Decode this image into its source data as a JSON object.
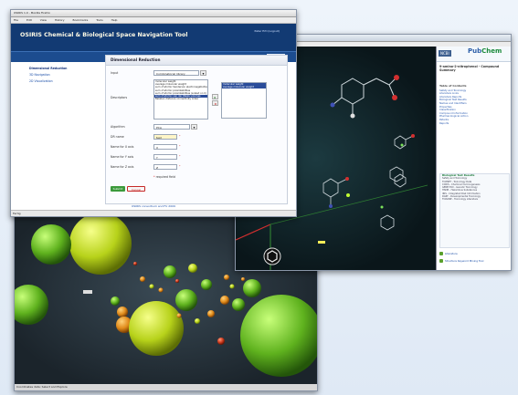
{
  "osiris": {
    "window_title": "OSIRIS 1.0 - Mozilla Firefox",
    "menu": [
      "File",
      "Edit",
      "View",
      "History",
      "Bookmarks",
      "Tools",
      "Help"
    ],
    "app_title": "OSIRIS Chemical & Biological Space Navigation Tool",
    "user_link": "Peter Ertl (Logout)",
    "help_label": "Help",
    "sidebar": [
      "Dimensional Reduction",
      "3D Navigation",
      "2D Visualization"
    ],
    "panel_title": "Dimensional Reduction",
    "fields": {
      "input_label": "Input",
      "input_value": "Combinatorial library",
      "descriptors_label": "Descriptors",
      "descriptors_available": [
        "molecular weight",
        "average molecular weight",
        "",
        "sum of atomic Sanderson electronegativities",
        "sum of atomic polarizabilities",
        "sum of atomic polarizabilities (scaled on C)",
        "sum of atomic van der Waals volumes",
        "Balaban distance connectivity index"
      ],
      "descriptors_selected": [
        "molecular weight",
        "average molecular weight"
      ],
      "algorithm_label": "Algorithm",
      "algorithm_value": "PCA",
      "dr_name_label": "DR name",
      "dr_name_value": "test",
      "x_axis_label": "Name for X axis",
      "x_axis_value": "X",
      "y_axis_label": "Name for Y axis",
      "y_axis_value": "Y",
      "z_axis_label": "Name for Z axis",
      "z_axis_value": "Z",
      "required_note": "required field",
      "submit_label": "Submit",
      "cancel_label": "Cancel"
    },
    "footer": "OSIRIS consortium and FU 2009",
    "status": "Fertig"
  },
  "pubchem": {
    "ncbi_label": "NCBI",
    "logo_main": "Pub",
    "logo_chem": "Chem",
    "compound_title": "9-amino-2-nitrophenol - Compound Summary",
    "toc_heading": "Table of Contents",
    "toc_items": [
      "Safety and Toxicology",
      "Literature Links",
      "Literature Reports",
      "Biological Test Results",
      "Names and Identifiers",
      "Properties",
      "Classification",
      "Compound Information",
      "Pharmacological Action",
      "Patents",
      "Reports"
    ],
    "bio_heading": "Biological Test Results",
    "bio_lines": [
      "Safety and Toxicology",
      "TOXNET - Toxicology Data",
      "CCRIS - Chemical Carcinogenesis",
      "GENE-TOX - Genetic Toxicology",
      "HSDB - Hazardous Substances",
      "IRIS - Integrated Risk Information",
      "DART - Developmental Toxicology",
      "TOXLINE - Toxicology Literature"
    ],
    "links": [
      "Literature",
      "Structure Keyword Mining Tool"
    ]
  },
  "bubble_view": {
    "status": "Coordinates data: Select and Explore"
  },
  "colors": {
    "osiris_banner": "#123a73",
    "accent_link": "#1a4ea8",
    "pubchem_green": "#1b8a3b"
  }
}
